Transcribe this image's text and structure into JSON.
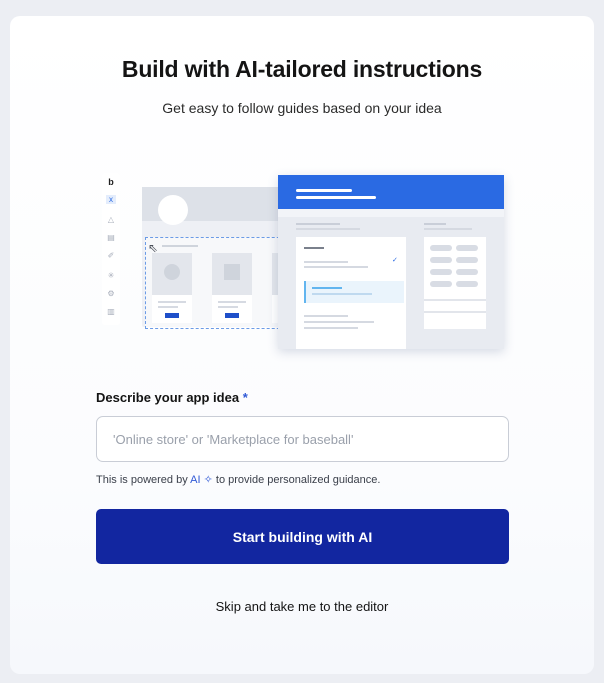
{
  "header": {
    "title": "Build with AI-tailored instructions",
    "subtitle": "Get easy to follow guides based on your idea"
  },
  "illustration": {
    "toolbar_items": [
      "b",
      "x",
      "△",
      "▤",
      "✐",
      "✳",
      "⚙",
      "▥"
    ],
    "colors": {
      "accent": "#2a6ae3",
      "highlight": "#62b5ef",
      "button": "#1e4fc9"
    }
  },
  "form": {
    "label": "Describe your app idea",
    "required_mark": "*",
    "input": {
      "placeholder": "'Online store' or 'Marketplace for baseball'",
      "value": ""
    },
    "helper": {
      "prefix": "This is powered by",
      "ai_text": "AI",
      "spark_icon": "✧",
      "suffix": "to provide personalized guidance."
    }
  },
  "actions": {
    "primary_label": "Start building with AI",
    "skip_label": "Skip and take me to the editor"
  },
  "theme": {
    "primary_button": "#1226a0",
    "link_accent": "#3059d6"
  }
}
